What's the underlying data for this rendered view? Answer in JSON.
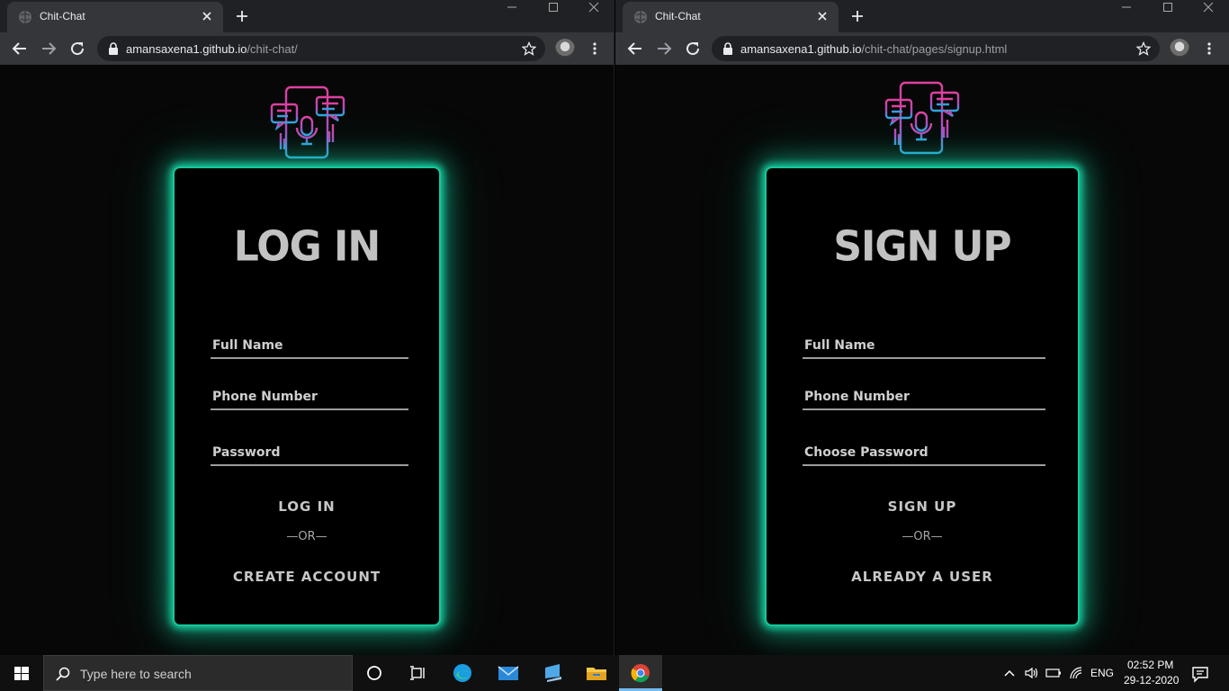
{
  "windows": [
    {
      "tab_title": "Chit-Chat",
      "url_domain": "amansaxena1.github.io",
      "url_path": "/chit-chat/",
      "card": {
        "title": "LOG IN",
        "fields": [
          {
            "placeholder": "Full Name",
            "value": ""
          },
          {
            "placeholder": "Phone Number",
            "value": ""
          },
          {
            "placeholder": "Password",
            "value": ""
          }
        ],
        "primary_action": "LOG IN",
        "separator": "—OR—",
        "secondary_action": "CREATE ACCOUNT"
      }
    },
    {
      "tab_title": "Chit-Chat",
      "url_domain": "amansaxena1.github.io",
      "url_path": "/chit-chat/pages/signup.html",
      "card": {
        "title": "SIGN UP",
        "fields": [
          {
            "placeholder": "Full Name",
            "value": ""
          },
          {
            "placeholder": "Phone Number",
            "value": ""
          },
          {
            "placeholder": "Choose Password",
            "value": ""
          }
        ],
        "primary_action": "SIGN UP",
        "separator": "—OR—",
        "secondary_action": "ALREADY A USER"
      }
    }
  ],
  "colors": {
    "glow": "#16c79a",
    "logo_pink": "#e040a0",
    "logo_blue": "#2aa8e0"
  },
  "taskbar": {
    "search_placeholder": "Type here to search",
    "pinned_icons": [
      "task-view-icon",
      "timeline-icon",
      "edge-icon",
      "mail-icon",
      "pc-icon",
      "file-explorer-icon",
      "chrome-icon"
    ],
    "language": "ENG",
    "time": "02:52 PM",
    "date": "29-12-2020"
  }
}
